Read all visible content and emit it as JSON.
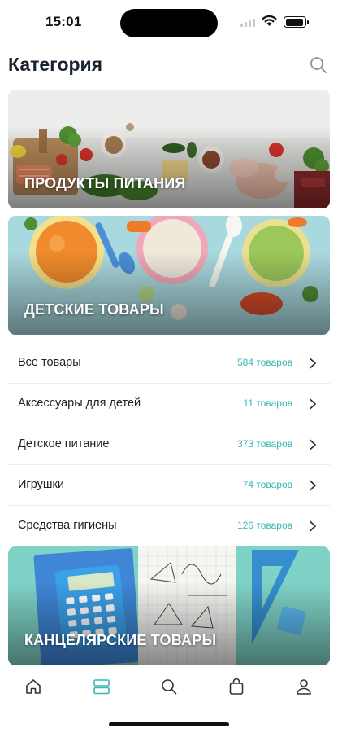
{
  "status_bar": {
    "time": "15:01"
  },
  "header": {
    "title": "Категория",
    "search_icon": "search-icon"
  },
  "banners": [
    {
      "label": "ПРОДУКТЫ ПИТАНИЯ"
    },
    {
      "label": "ДЕТСКИЕ ТОВАРЫ"
    },
    {
      "label": "КАНЦЕЛЯРСКИЕ ТОВАРЫ"
    }
  ],
  "categories": [
    {
      "label": "Все товары",
      "count": "584 товаров"
    },
    {
      "label": "Аксессуары для детей",
      "count": "11 товаров"
    },
    {
      "label": "Детское питание",
      "count": "373 товаров"
    },
    {
      "label": "Игрушки",
      "count": "74 товаров"
    },
    {
      "label": "Средства гигиены",
      "count": "126 товаров"
    }
  ],
  "tab_bar": {
    "tabs": [
      {
        "icon": "home-icon"
      },
      {
        "icon": "categories-icon",
        "active": true
      },
      {
        "icon": "search-icon"
      },
      {
        "icon": "shopping-bag-icon"
      },
      {
        "icon": "profile-icon"
      }
    ]
  },
  "colors": {
    "accent": "#37b7b7",
    "title": "#1b2330",
    "divider": "#ececec"
  }
}
